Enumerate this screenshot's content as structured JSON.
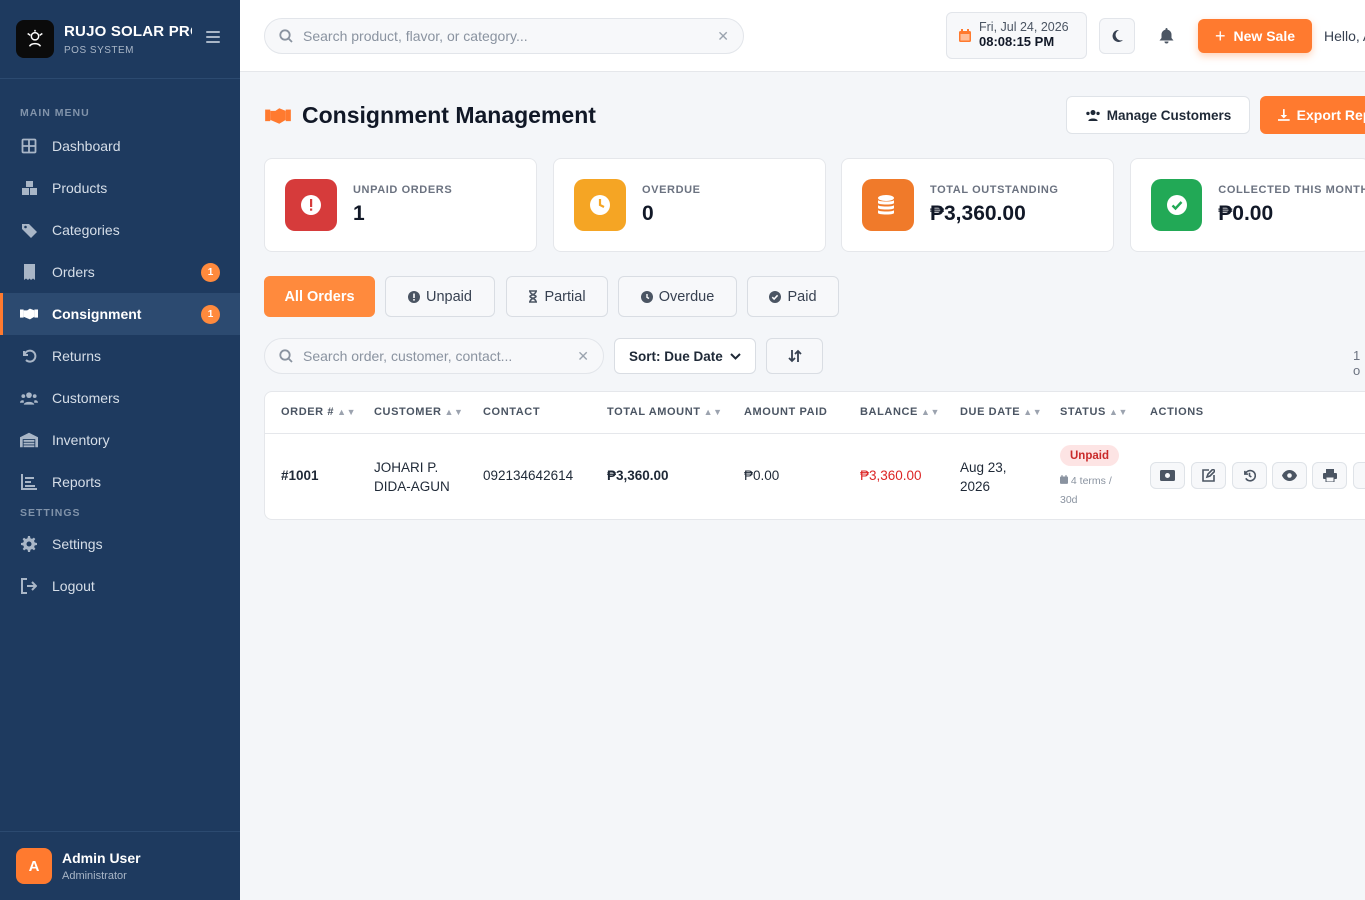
{
  "brand": {
    "name": "RUJO SOLAR PRO",
    "subtitle": "POS SYSTEM"
  },
  "sidebar": {
    "main_menu_label": "MAIN MENU",
    "settings_label": "SETTINGS",
    "items": [
      {
        "label": "Dashboard",
        "icon": "grid-icon"
      },
      {
        "label": "Products",
        "icon": "boxes-icon"
      },
      {
        "label": "Categories",
        "icon": "tags-icon"
      },
      {
        "label": "Orders",
        "icon": "receipt-icon",
        "badge": "1"
      },
      {
        "label": "Consignment",
        "icon": "handshake-icon",
        "badge": "1",
        "active": true
      },
      {
        "label": "Returns",
        "icon": "undo-icon"
      },
      {
        "label": "Customers",
        "icon": "users-icon"
      },
      {
        "label": "Inventory",
        "icon": "warehouse-icon"
      },
      {
        "label": "Reports",
        "icon": "chart-icon"
      }
    ],
    "settings_items": [
      {
        "label": "Settings",
        "icon": "gear-icon"
      },
      {
        "label": "Logout",
        "icon": "logout-icon"
      }
    ],
    "user": {
      "initial": "A",
      "name": "Admin User",
      "role": "Administrator"
    }
  },
  "topbar": {
    "search_placeholder": "Search product, flavor, or category...",
    "date": "Fri, Jul 24, 2026",
    "time": "08:08:15 PM",
    "new_sale_label": "New Sale",
    "greeting": "Hello, A"
  },
  "page": {
    "title": "Consignment Management",
    "manage_customers_label": "Manage Customers",
    "export_label": "Export Report"
  },
  "stats": [
    {
      "label": "UNPAID ORDERS",
      "value": "1",
      "color": "#d63b3b"
    },
    {
      "label": "OVERDUE",
      "value": "0",
      "color": "#f5a524"
    },
    {
      "label": "TOTAL OUTSTANDING",
      "value": "₱3,360.00",
      "color": "#f07a2a"
    },
    {
      "label": "COLLECTED THIS MONTH",
      "value": "₱0.00",
      "color": "#22a956"
    }
  ],
  "filters": [
    {
      "label": "All Orders",
      "active": true
    },
    {
      "label": "Unpaid"
    },
    {
      "label": "Partial"
    },
    {
      "label": "Overdue"
    },
    {
      "label": "Paid"
    }
  ],
  "toolbar": {
    "search_placeholder": "Search order, customer, contact...",
    "sort_label": "Sort: Due Date",
    "count_text": "1 o"
  },
  "table": {
    "columns": [
      "ORDER #",
      "CUSTOMER",
      "CONTACT",
      "TOTAL AMOUNT",
      "AMOUNT PAID",
      "BALANCE",
      "DUE DATE",
      "STATUS",
      "ACTIONS"
    ],
    "rows": [
      {
        "order": "#1001",
        "customer_line1": "JOHARI P.",
        "customer_line2": "DIDA-AGUN",
        "contact": "092134642614",
        "total": "₱3,360.00",
        "paid": "₱0.00",
        "balance": "₱3,360.00",
        "due_line1": "Aug 23,",
        "due_line2": "2026",
        "status": "Unpaid",
        "terms_line1": "4 terms /",
        "terms_line2": "30d"
      }
    ]
  },
  "colors": {
    "accent": "#ff7a2f",
    "sidebar": "#1e3a5f"
  }
}
